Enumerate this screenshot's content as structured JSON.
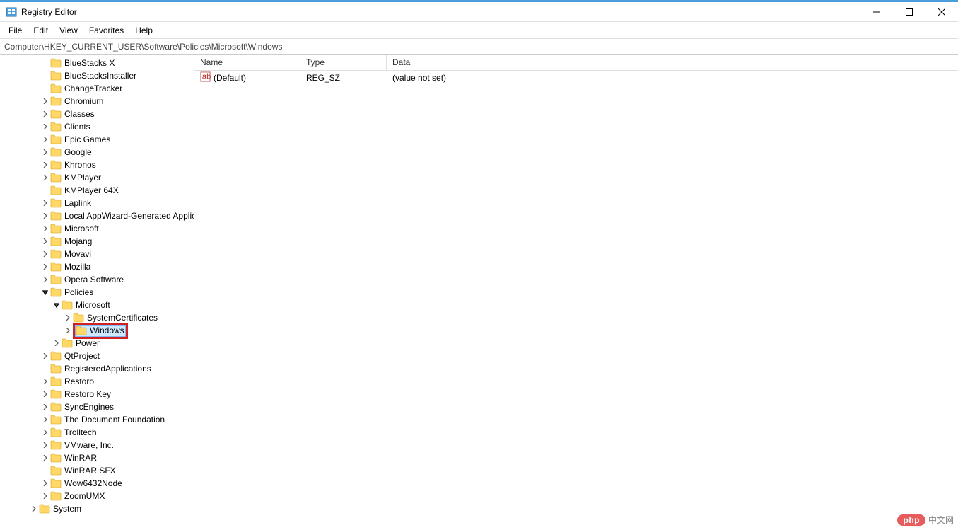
{
  "window": {
    "title": "Registry Editor"
  },
  "menubar": [
    "File",
    "Edit",
    "View",
    "Favorites",
    "Help"
  ],
  "address": "Computer\\HKEY_CURRENT_USER\\Software\\Policies\\Microsoft\\Windows",
  "tree": [
    {
      "level": 3,
      "expand": "none",
      "label": "BlueStacks X"
    },
    {
      "level": 3,
      "expand": "none",
      "label": "BlueStacksInstaller"
    },
    {
      "level": 3,
      "expand": "none",
      "label": "ChangeTracker"
    },
    {
      "level": 3,
      "expand": "closed",
      "label": "Chromium"
    },
    {
      "level": 3,
      "expand": "closed",
      "label": "Classes"
    },
    {
      "level": 3,
      "expand": "closed",
      "label": "Clients"
    },
    {
      "level": 3,
      "expand": "closed",
      "label": "Epic Games"
    },
    {
      "level": 3,
      "expand": "closed",
      "label": "Google"
    },
    {
      "level": 3,
      "expand": "closed",
      "label": "Khronos"
    },
    {
      "level": 3,
      "expand": "closed",
      "label": "KMPlayer"
    },
    {
      "level": 3,
      "expand": "none",
      "label": "KMPlayer 64X"
    },
    {
      "level": 3,
      "expand": "closed",
      "label": "Laplink"
    },
    {
      "level": 3,
      "expand": "closed",
      "label": "Local AppWizard-Generated Applications"
    },
    {
      "level": 3,
      "expand": "closed",
      "label": "Microsoft"
    },
    {
      "level": 3,
      "expand": "closed",
      "label": "Mojang"
    },
    {
      "level": 3,
      "expand": "closed",
      "label": "Movavi"
    },
    {
      "level": 3,
      "expand": "closed",
      "label": "Mozilla"
    },
    {
      "level": 3,
      "expand": "closed",
      "label": "Opera Software"
    },
    {
      "level": 3,
      "expand": "open",
      "label": "Policies"
    },
    {
      "level": 4,
      "expand": "open",
      "label": "Microsoft"
    },
    {
      "level": 5,
      "expand": "closed",
      "label": "SystemCertificates"
    },
    {
      "level": 5,
      "expand": "closed",
      "label": "Windows",
      "selected": true,
      "highlighted": true
    },
    {
      "level": 4,
      "expand": "closed",
      "label": "Power"
    },
    {
      "level": 3,
      "expand": "closed",
      "label": "QtProject"
    },
    {
      "level": 3,
      "expand": "none",
      "label": "RegisteredApplications"
    },
    {
      "level": 3,
      "expand": "closed",
      "label": "Restoro"
    },
    {
      "level": 3,
      "expand": "closed",
      "label": "Restoro Key"
    },
    {
      "level": 3,
      "expand": "closed",
      "label": "SyncEngines"
    },
    {
      "level": 3,
      "expand": "closed",
      "label": "The Document Foundation"
    },
    {
      "level": 3,
      "expand": "closed",
      "label": "Trolltech"
    },
    {
      "level": 3,
      "expand": "closed",
      "label": "VMware, Inc."
    },
    {
      "level": 3,
      "expand": "closed",
      "label": "WinRAR"
    },
    {
      "level": 3,
      "expand": "none",
      "label": "WinRAR SFX"
    },
    {
      "level": 3,
      "expand": "closed",
      "label": "Wow6432Node"
    },
    {
      "level": 3,
      "expand": "closed",
      "label": "ZoomUMX"
    },
    {
      "level": 2,
      "expand": "closed",
      "label": "System"
    }
  ],
  "list": {
    "columns": {
      "name": "Name",
      "type": "Type",
      "data": "Data"
    },
    "rows": [
      {
        "name": "(Default)",
        "type": "REG_SZ",
        "data": "(value not set)",
        "icon": "string"
      }
    ]
  },
  "watermark": {
    "pill": "php",
    "text": "中文网"
  }
}
